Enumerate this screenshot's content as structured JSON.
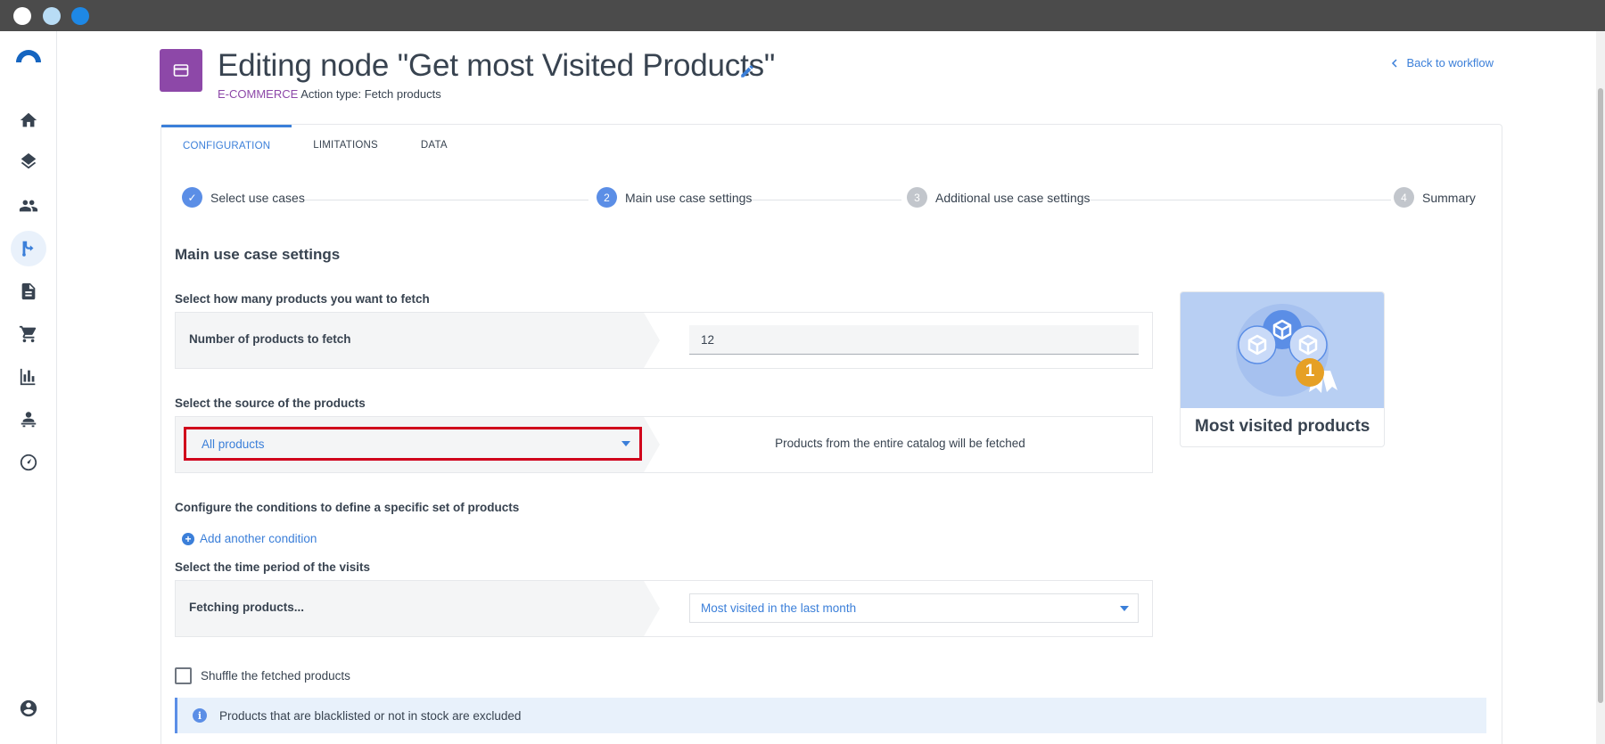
{
  "window": {
    "controls": [
      "close",
      "minimize",
      "maximize"
    ]
  },
  "sidebar": {
    "items": [
      {
        "icon": "home-icon",
        "active": false
      },
      {
        "icon": "layers-icon",
        "active": false
      },
      {
        "icon": "people-icon",
        "active": false
      },
      {
        "icon": "workflow-icon",
        "active": true
      },
      {
        "icon": "document-icon",
        "active": false
      },
      {
        "icon": "cart-icon",
        "active": false
      },
      {
        "icon": "bar-chart-icon",
        "active": false
      },
      {
        "icon": "person-desk-icon",
        "active": false
      },
      {
        "icon": "dashboard-icon",
        "active": false
      }
    ],
    "user_icon": "account-circle-icon"
  },
  "header": {
    "title": "Editing node \"Get most Visited Products\"",
    "category": "E-COMMERCE",
    "action_type": "Action type: Fetch products",
    "back_link": "Back to workflow",
    "accent_color": "#8d48a8"
  },
  "tabs": [
    {
      "label": "CONFIGURATION",
      "active": true
    },
    {
      "label": "LIMITATIONS",
      "active": false
    },
    {
      "label": "DATA",
      "active": false
    }
  ],
  "stepper": [
    {
      "number": "✓",
      "label": "Select use cases",
      "state": "done"
    },
    {
      "number": "2",
      "label": "Main use case settings",
      "state": "current"
    },
    {
      "number": "3",
      "label": "Additional use case settings",
      "state": "todo"
    },
    {
      "number": "4",
      "label": "Summary",
      "state": "todo"
    }
  ],
  "main": {
    "section_title": "Main use case settings",
    "fetch_count": {
      "label": "Select how many products you want to fetch",
      "row_label": "Number of products to fetch",
      "value": "12"
    },
    "source": {
      "label": "Select the source of the products",
      "selected": "All products",
      "hint": "Products from the entire catalog will be fetched"
    },
    "conditions": {
      "label": "Configure the conditions to define a specific set of products",
      "add_label": "Add another condition"
    },
    "period": {
      "label": "Select the time period of the visits",
      "row_label": "Fetching products...",
      "selected": "Most visited in the last month"
    },
    "shuffle_label": "Shuffle the fetched products",
    "info_text": "Products that are blacklisted or not in stock are excluded"
  },
  "preview": {
    "title": "Most visited products",
    "badge_number": "1"
  }
}
